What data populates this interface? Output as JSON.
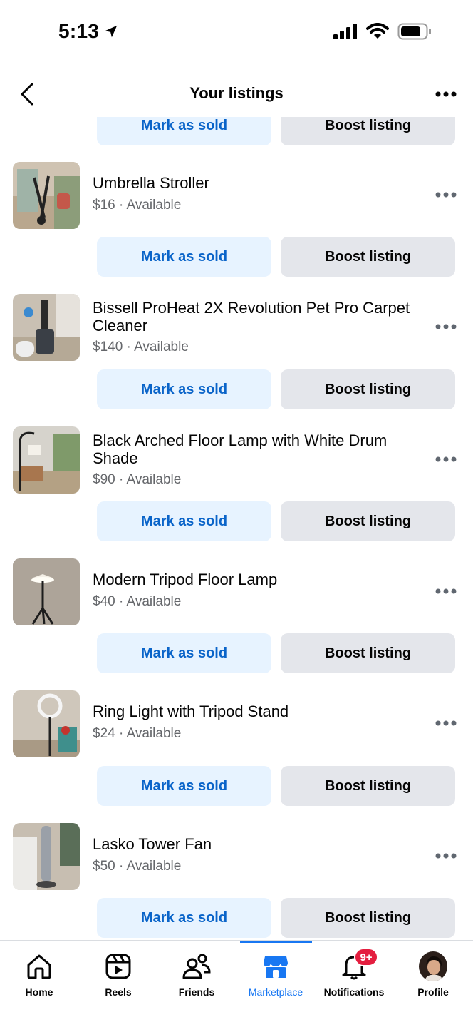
{
  "status_bar": {
    "time": "5:13"
  },
  "header": {
    "title": "Your listings"
  },
  "partial_listing": {
    "mark_sold_label": "Mark as sold",
    "boost_label": "Boost listing"
  },
  "listings": [
    {
      "title": "Umbrella Stroller",
      "price": "$16",
      "status": "Available",
      "meta": "$16 · Available",
      "mark_sold_label": "Mark as sold",
      "boost_label": "Boost listing"
    },
    {
      "title": "Bissell ProHeat 2X Revolution Pet Pro Carpet Cleaner",
      "price": "$140",
      "status": "Available",
      "meta": "$140 · Available",
      "mark_sold_label": "Mark as sold",
      "boost_label": "Boost listing"
    },
    {
      "title": "Black Arched Floor Lamp with White Drum Shade",
      "price": "$90",
      "status": "Available",
      "meta": "$90 · Available",
      "mark_sold_label": "Mark as sold",
      "boost_label": "Boost listing"
    },
    {
      "title": "Modern Tripod Floor Lamp",
      "price": "$40",
      "status": "Available",
      "meta": "$40 · Available",
      "mark_sold_label": "Mark as sold",
      "boost_label": "Boost listing"
    },
    {
      "title": "Ring Light with Tripod Stand",
      "price": "$24",
      "status": "Available",
      "meta": "$24 · Available",
      "mark_sold_label": "Mark as sold",
      "boost_label": "Boost listing"
    },
    {
      "title": "Lasko Tower Fan",
      "price": "$50",
      "status": "Available",
      "meta": "$50 · Available",
      "mark_sold_label": "Mark as sold",
      "boost_label": "Boost listing"
    }
  ],
  "bottom_nav": {
    "items": [
      {
        "label": "Home",
        "icon": "home-icon"
      },
      {
        "label": "Reels",
        "icon": "reels-icon"
      },
      {
        "label": "Friends",
        "icon": "friends-icon"
      },
      {
        "label": "Marketplace",
        "icon": "marketplace-icon",
        "active": true
      },
      {
        "label": "Notifications",
        "icon": "bell-icon",
        "badge": "9+"
      },
      {
        "label": "Profile",
        "icon": "avatar"
      }
    ]
  },
  "colors": {
    "accent": "#1877f2",
    "mark_sold_bg": "#e7f3ff",
    "mark_sold_text": "#0a64c9",
    "boost_bg": "#e4e6eb",
    "secondary_text": "#65676b",
    "badge": "#e41e3f"
  }
}
